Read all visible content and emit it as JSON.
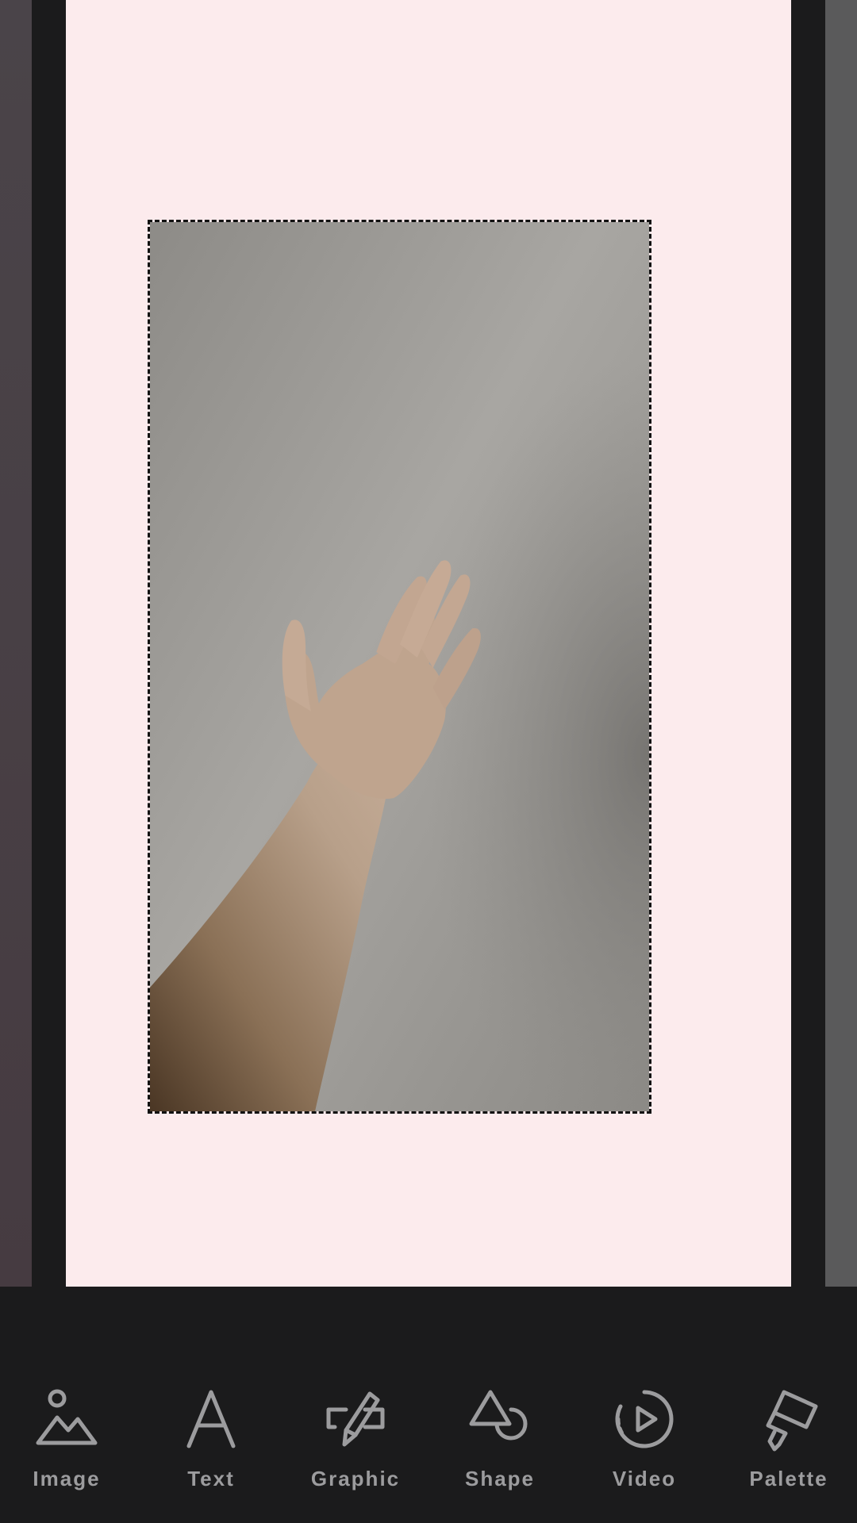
{
  "editor": {
    "canvas_color": "#fcebed",
    "background_color": "#1b1b1c",
    "selected_element": {
      "type": "image",
      "description_icon": "photo-of-raised-hand"
    }
  },
  "toolbar": {
    "items": [
      {
        "label": "Image",
        "icon": "image-icon"
      },
      {
        "label": "Text",
        "icon": "text-icon"
      },
      {
        "label": "Graphic",
        "icon": "graphic-icon"
      },
      {
        "label": "Shape",
        "icon": "shape-icon"
      },
      {
        "label": "Video",
        "icon": "video-icon"
      },
      {
        "label": "Palette",
        "icon": "palette-icon"
      }
    ],
    "label_color": "#9c9c9e"
  }
}
